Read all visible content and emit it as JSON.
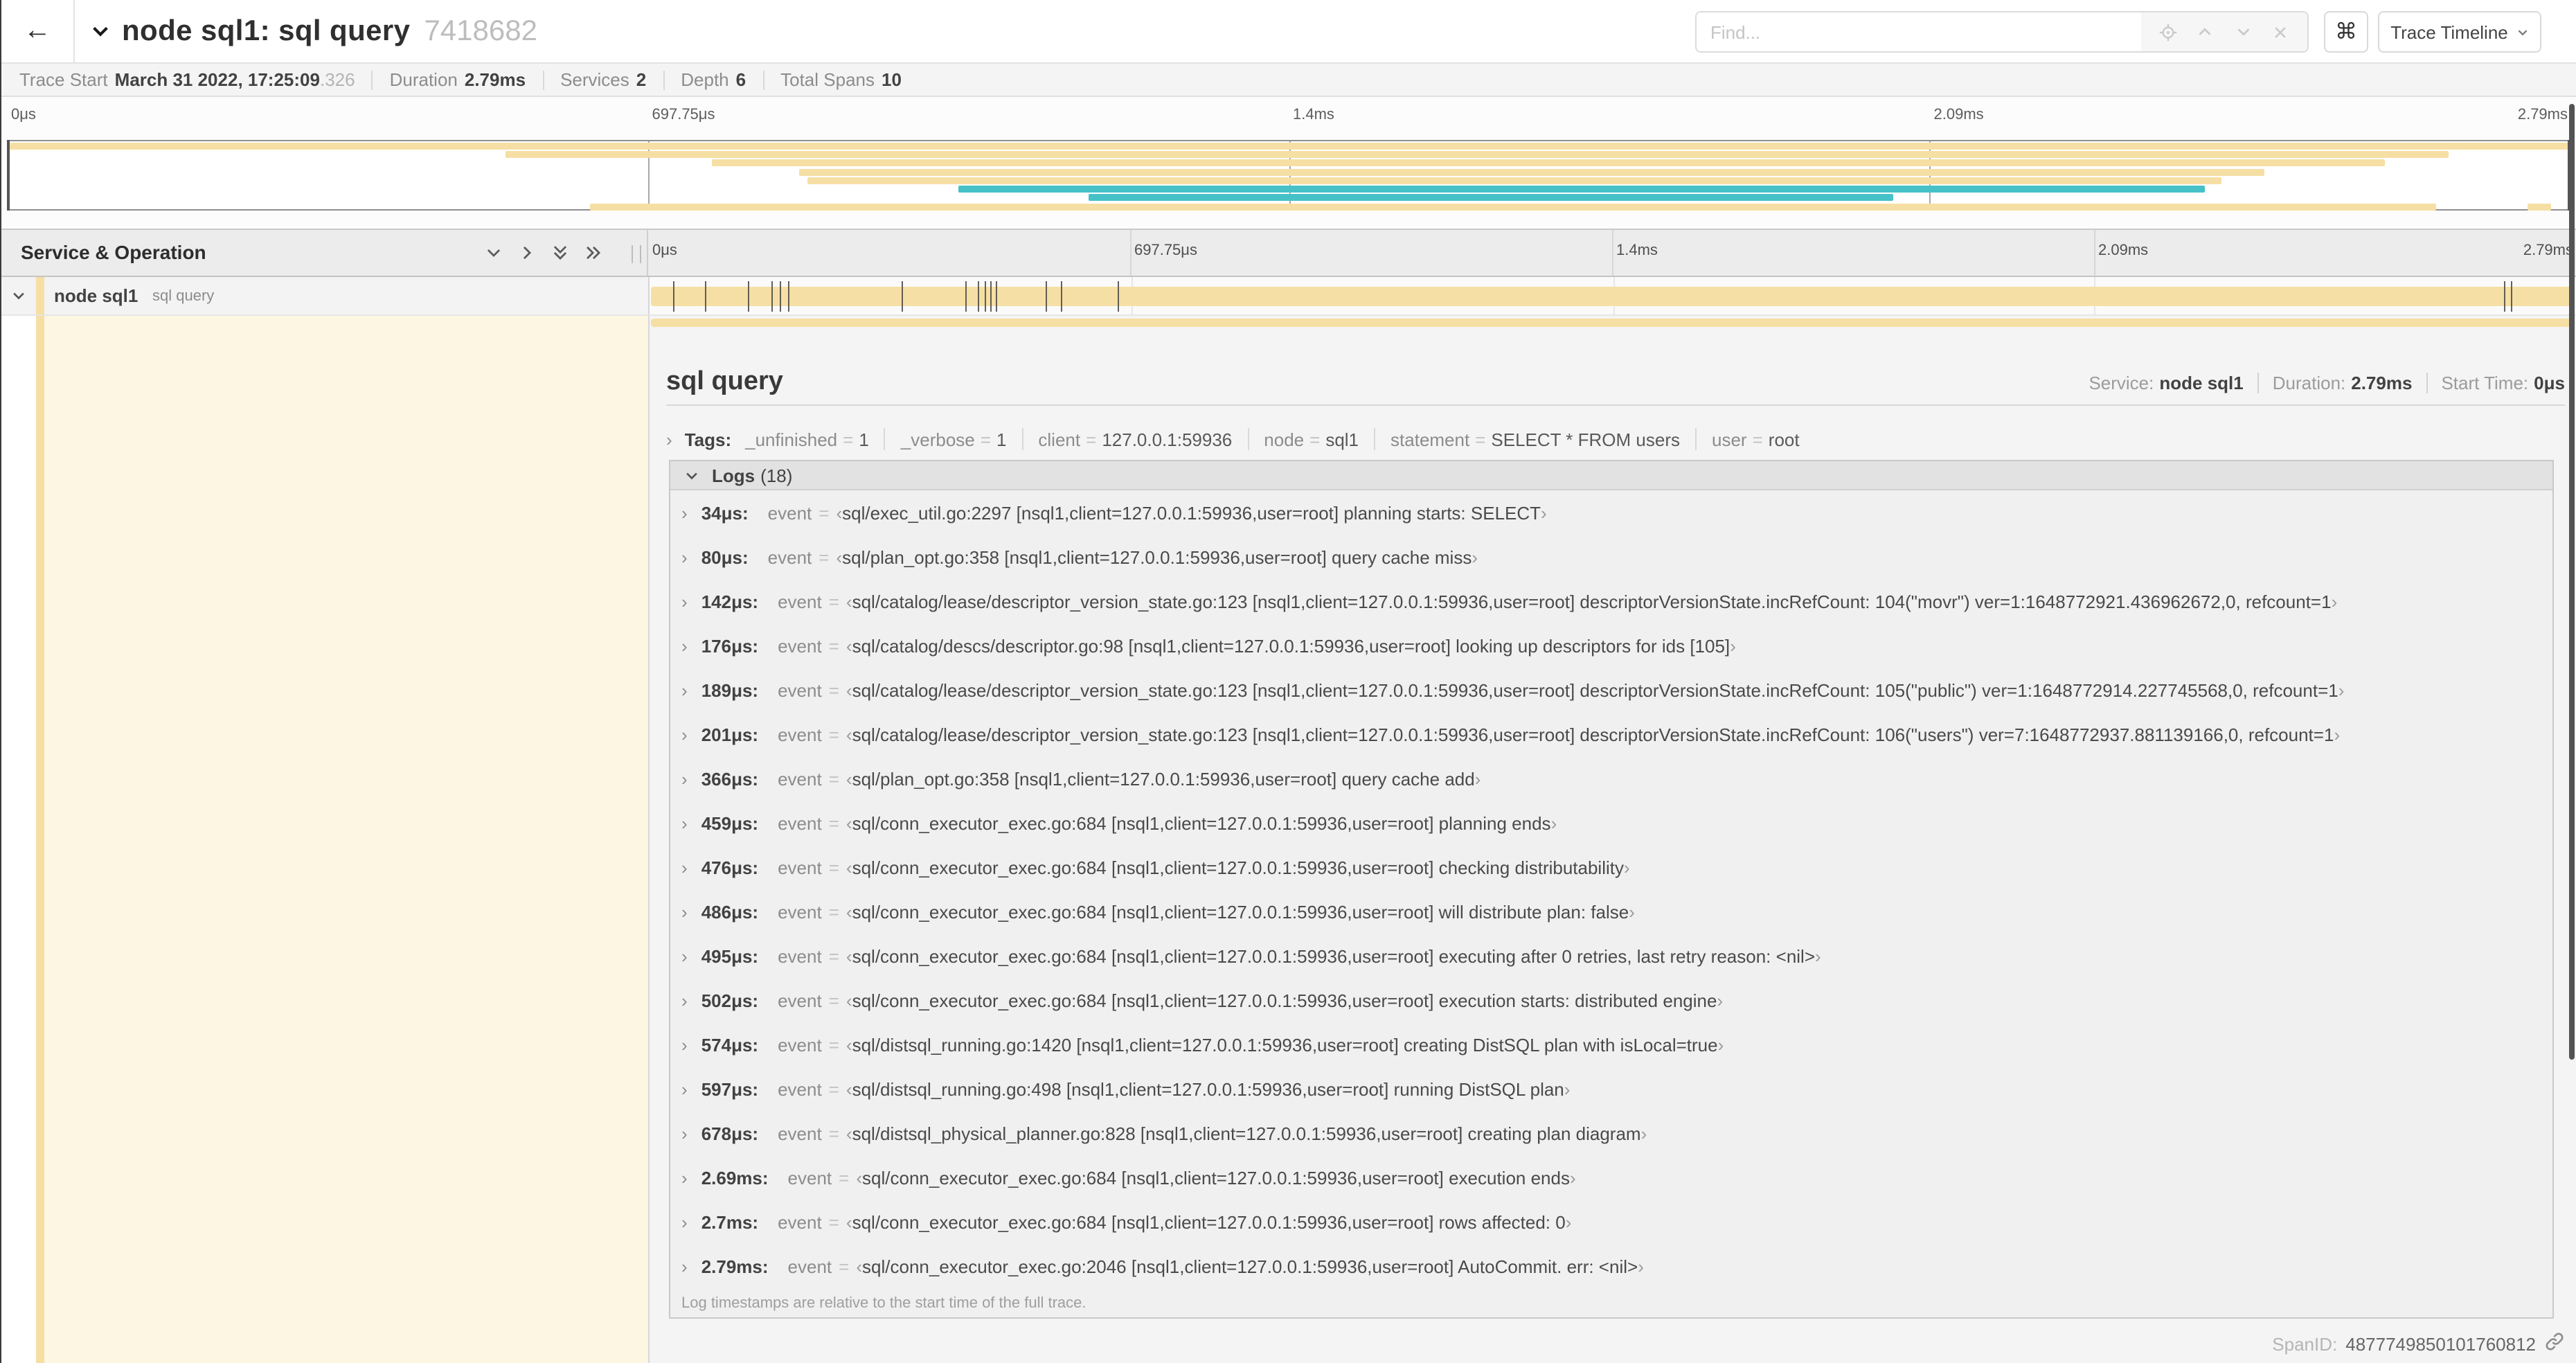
{
  "topbar": {
    "back": "←",
    "title": "node sql1: sql query",
    "trace_id": "7418682",
    "find_placeholder": "Find...",
    "kbd_shortcut": "⌘",
    "view_button": "Trace Timeline"
  },
  "summary": {
    "items": [
      {
        "label": "Trace Start",
        "value": "March 31 2022, 17:25:09",
        "suffix": ".326"
      },
      {
        "label": "Duration",
        "value": "2.79ms"
      },
      {
        "label": "Services",
        "value": "2"
      },
      {
        "label": "Depth",
        "value": "6"
      },
      {
        "label": "Total Spans",
        "value": "10"
      }
    ]
  },
  "ruler_ticks": [
    {
      "pct": 0,
      "label": "0μs"
    },
    {
      "pct": 25,
      "label": "697.75μs"
    },
    {
      "pct": 50,
      "label": "1.4ms"
    },
    {
      "pct": 75,
      "label": "2.09ms"
    },
    {
      "pct": 100,
      "label": "2.79ms"
    }
  ],
  "minimap": {
    "bars": [
      {
        "row": 0,
        "start": 0,
        "end": 100,
        "color": "tan"
      },
      {
        "row": 1,
        "start": 19.4,
        "end": 95.3,
        "color": "tan"
      },
      {
        "row": 2,
        "start": 27.5,
        "end": 92.8,
        "color": "tan"
      },
      {
        "row": 3,
        "start": 30.9,
        "end": 88.1,
        "color": "tan"
      },
      {
        "row": 4,
        "start": 31.2,
        "end": 86.4,
        "color": "tan"
      },
      {
        "row": 5,
        "start": 37.1,
        "end": 85.8,
        "color": "teal"
      },
      {
        "row": 6,
        "start": 42.2,
        "end": 73.6,
        "color": "teal"
      },
      {
        "row": 7,
        "start": 22.7,
        "end": 94.8,
        "color": "tan"
      },
      {
        "row": 7,
        "start": 98.4,
        "end": 99.3,
        "color": "tan"
      }
    ]
  },
  "timeline": {
    "column_header": "Service & Operation",
    "row": {
      "service": "node sql1",
      "operation": "sql query"
    },
    "span_tick_pcts": [
      1.22,
      2.87,
      5.09,
      6.31,
      6.77,
      7.2,
      13.12,
      16.45,
      17.06,
      17.42,
      17.74,
      17.99,
      20.57,
      21.4,
      24.3,
      96.42,
      96.77,
      100
    ]
  },
  "detail": {
    "title": "sql query",
    "service_label": "Service:",
    "service": "node sql1",
    "duration_label": "Duration:",
    "duration": "2.79ms",
    "start_label": "Start Time:",
    "start": "0μs",
    "tags_label": "Tags:",
    "tags": [
      {
        "key": "_unfinished",
        "value": "1"
      },
      {
        "key": "_verbose",
        "value": "1"
      },
      {
        "key": "client",
        "value": "127.0.0.1:59936"
      },
      {
        "key": "node",
        "value": "sql1"
      },
      {
        "key": "statement",
        "value": "SELECT * FROM users"
      },
      {
        "key": "user",
        "value": "root"
      }
    ],
    "logs_label": "Logs",
    "logs_count": "(18)",
    "logs": [
      {
        "time": "34μs:",
        "field": "event",
        "value": "sql/exec_util.go:2297 [nsql1,client=127.0.0.1:59936,user=root] planning starts: SELECT"
      },
      {
        "time": "80μs:",
        "field": "event",
        "value": "sql/plan_opt.go:358 [nsql1,client=127.0.0.1:59936,user=root] query cache miss"
      },
      {
        "time": "142μs:",
        "field": "event",
        "value": "sql/catalog/lease/descriptor_version_state.go:123 [nsql1,client=127.0.0.1:59936,user=root] descriptorVersionState.incRefCount: 104(\"movr\") ver=1:1648772921.436962672,0, refcount=1"
      },
      {
        "time": "176μs:",
        "field": "event",
        "value": "sql/catalog/descs/descriptor.go:98 [nsql1,client=127.0.0.1:59936,user=root] looking up descriptors for ids [105]"
      },
      {
        "time": "189μs:",
        "field": "event",
        "value": "sql/catalog/lease/descriptor_version_state.go:123 [nsql1,client=127.0.0.1:59936,user=root] descriptorVersionState.incRefCount: 105(\"public\") ver=1:1648772914.227745568,0, refcount=1"
      },
      {
        "time": "201μs:",
        "field": "event",
        "value": "sql/catalog/lease/descriptor_version_state.go:123 [nsql1,client=127.0.0.1:59936,user=root] descriptorVersionState.incRefCount: 106(\"users\") ver=7:1648772937.881139166,0, refcount=1"
      },
      {
        "time": "366μs:",
        "field": "event",
        "value": "sql/plan_opt.go:358 [nsql1,client=127.0.0.1:59936,user=root] query cache add"
      },
      {
        "time": "459μs:",
        "field": "event",
        "value": "sql/conn_executor_exec.go:684 [nsql1,client=127.0.0.1:59936,user=root] planning ends"
      },
      {
        "time": "476μs:",
        "field": "event",
        "value": "sql/conn_executor_exec.go:684 [nsql1,client=127.0.0.1:59936,user=root] checking distributability"
      },
      {
        "time": "486μs:",
        "field": "event",
        "value": "sql/conn_executor_exec.go:684 [nsql1,client=127.0.0.1:59936,user=root] will distribute plan: false"
      },
      {
        "time": "495μs:",
        "field": "event",
        "value": "sql/conn_executor_exec.go:684 [nsql1,client=127.0.0.1:59936,user=root] executing after 0 retries, last retry reason: <nil>"
      },
      {
        "time": "502μs:",
        "field": "event",
        "value": "sql/conn_executor_exec.go:684 [nsql1,client=127.0.0.1:59936,user=root] execution starts: distributed engine"
      },
      {
        "time": "574μs:",
        "field": "event",
        "value": "sql/distsql_running.go:1420 [nsql1,client=127.0.0.1:59936,user=root] creating DistSQL plan with isLocal=true"
      },
      {
        "time": "597μs:",
        "field": "event",
        "value": "sql/distsql_running.go:498 [nsql1,client=127.0.0.1:59936,user=root] running DistSQL plan"
      },
      {
        "time": "678μs:",
        "field": "event",
        "value": "sql/distsql_physical_planner.go:828 [nsql1,client=127.0.0.1:59936,user=root] creating plan diagram"
      },
      {
        "time": "2.69ms:",
        "field": "event",
        "value": "sql/conn_executor_exec.go:684 [nsql1,client=127.0.0.1:59936,user=root] execution ends"
      },
      {
        "time": "2.7ms:",
        "field": "event",
        "value": "sql/conn_executor_exec.go:684 [nsql1,client=127.0.0.1:59936,user=root] rows affected: 0"
      },
      {
        "time": "2.79ms:",
        "field": "event",
        "value": "sql/conn_executor_exec.go:2046 [nsql1,client=127.0.0.1:59936,user=root] AutoCommit. err: <nil>"
      }
    ],
    "note": "Log timestamps are relative to the start time of the full trace.",
    "spanid_label": "SpanID:",
    "spanid": "4877749850101760812"
  },
  "colors": {
    "tan": "#F6DFA4",
    "teal": "#45C1C7",
    "cream": "#FDF6E3"
  }
}
